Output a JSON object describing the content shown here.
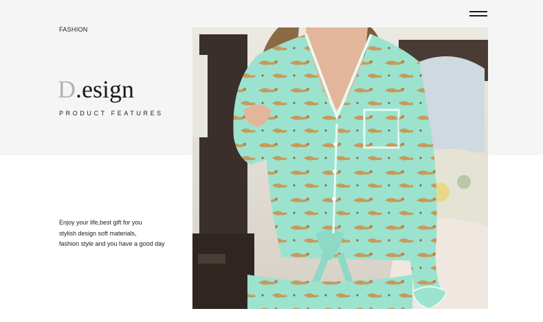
{
  "header": {
    "section_label": "FASHION",
    "menu_icon": "hamburger-menu-icon"
  },
  "hero": {
    "title_initial": "D",
    "title_dot": ".",
    "title_rest": "esign",
    "subtitle": "PRODUCT FEATURES"
  },
  "description": {
    "lines": [
      "Enjoy your life,best gift for you",
      "stylish design soft materials,",
      "fashion style and you have a good day"
    ]
  },
  "colors": {
    "top_band": "#f5f5f5",
    "text": "#1a1a1a",
    "title_initial": "#b3b3b3",
    "pajama_mint": "#9be3cf",
    "leopard_tan": "#c79a5a"
  }
}
